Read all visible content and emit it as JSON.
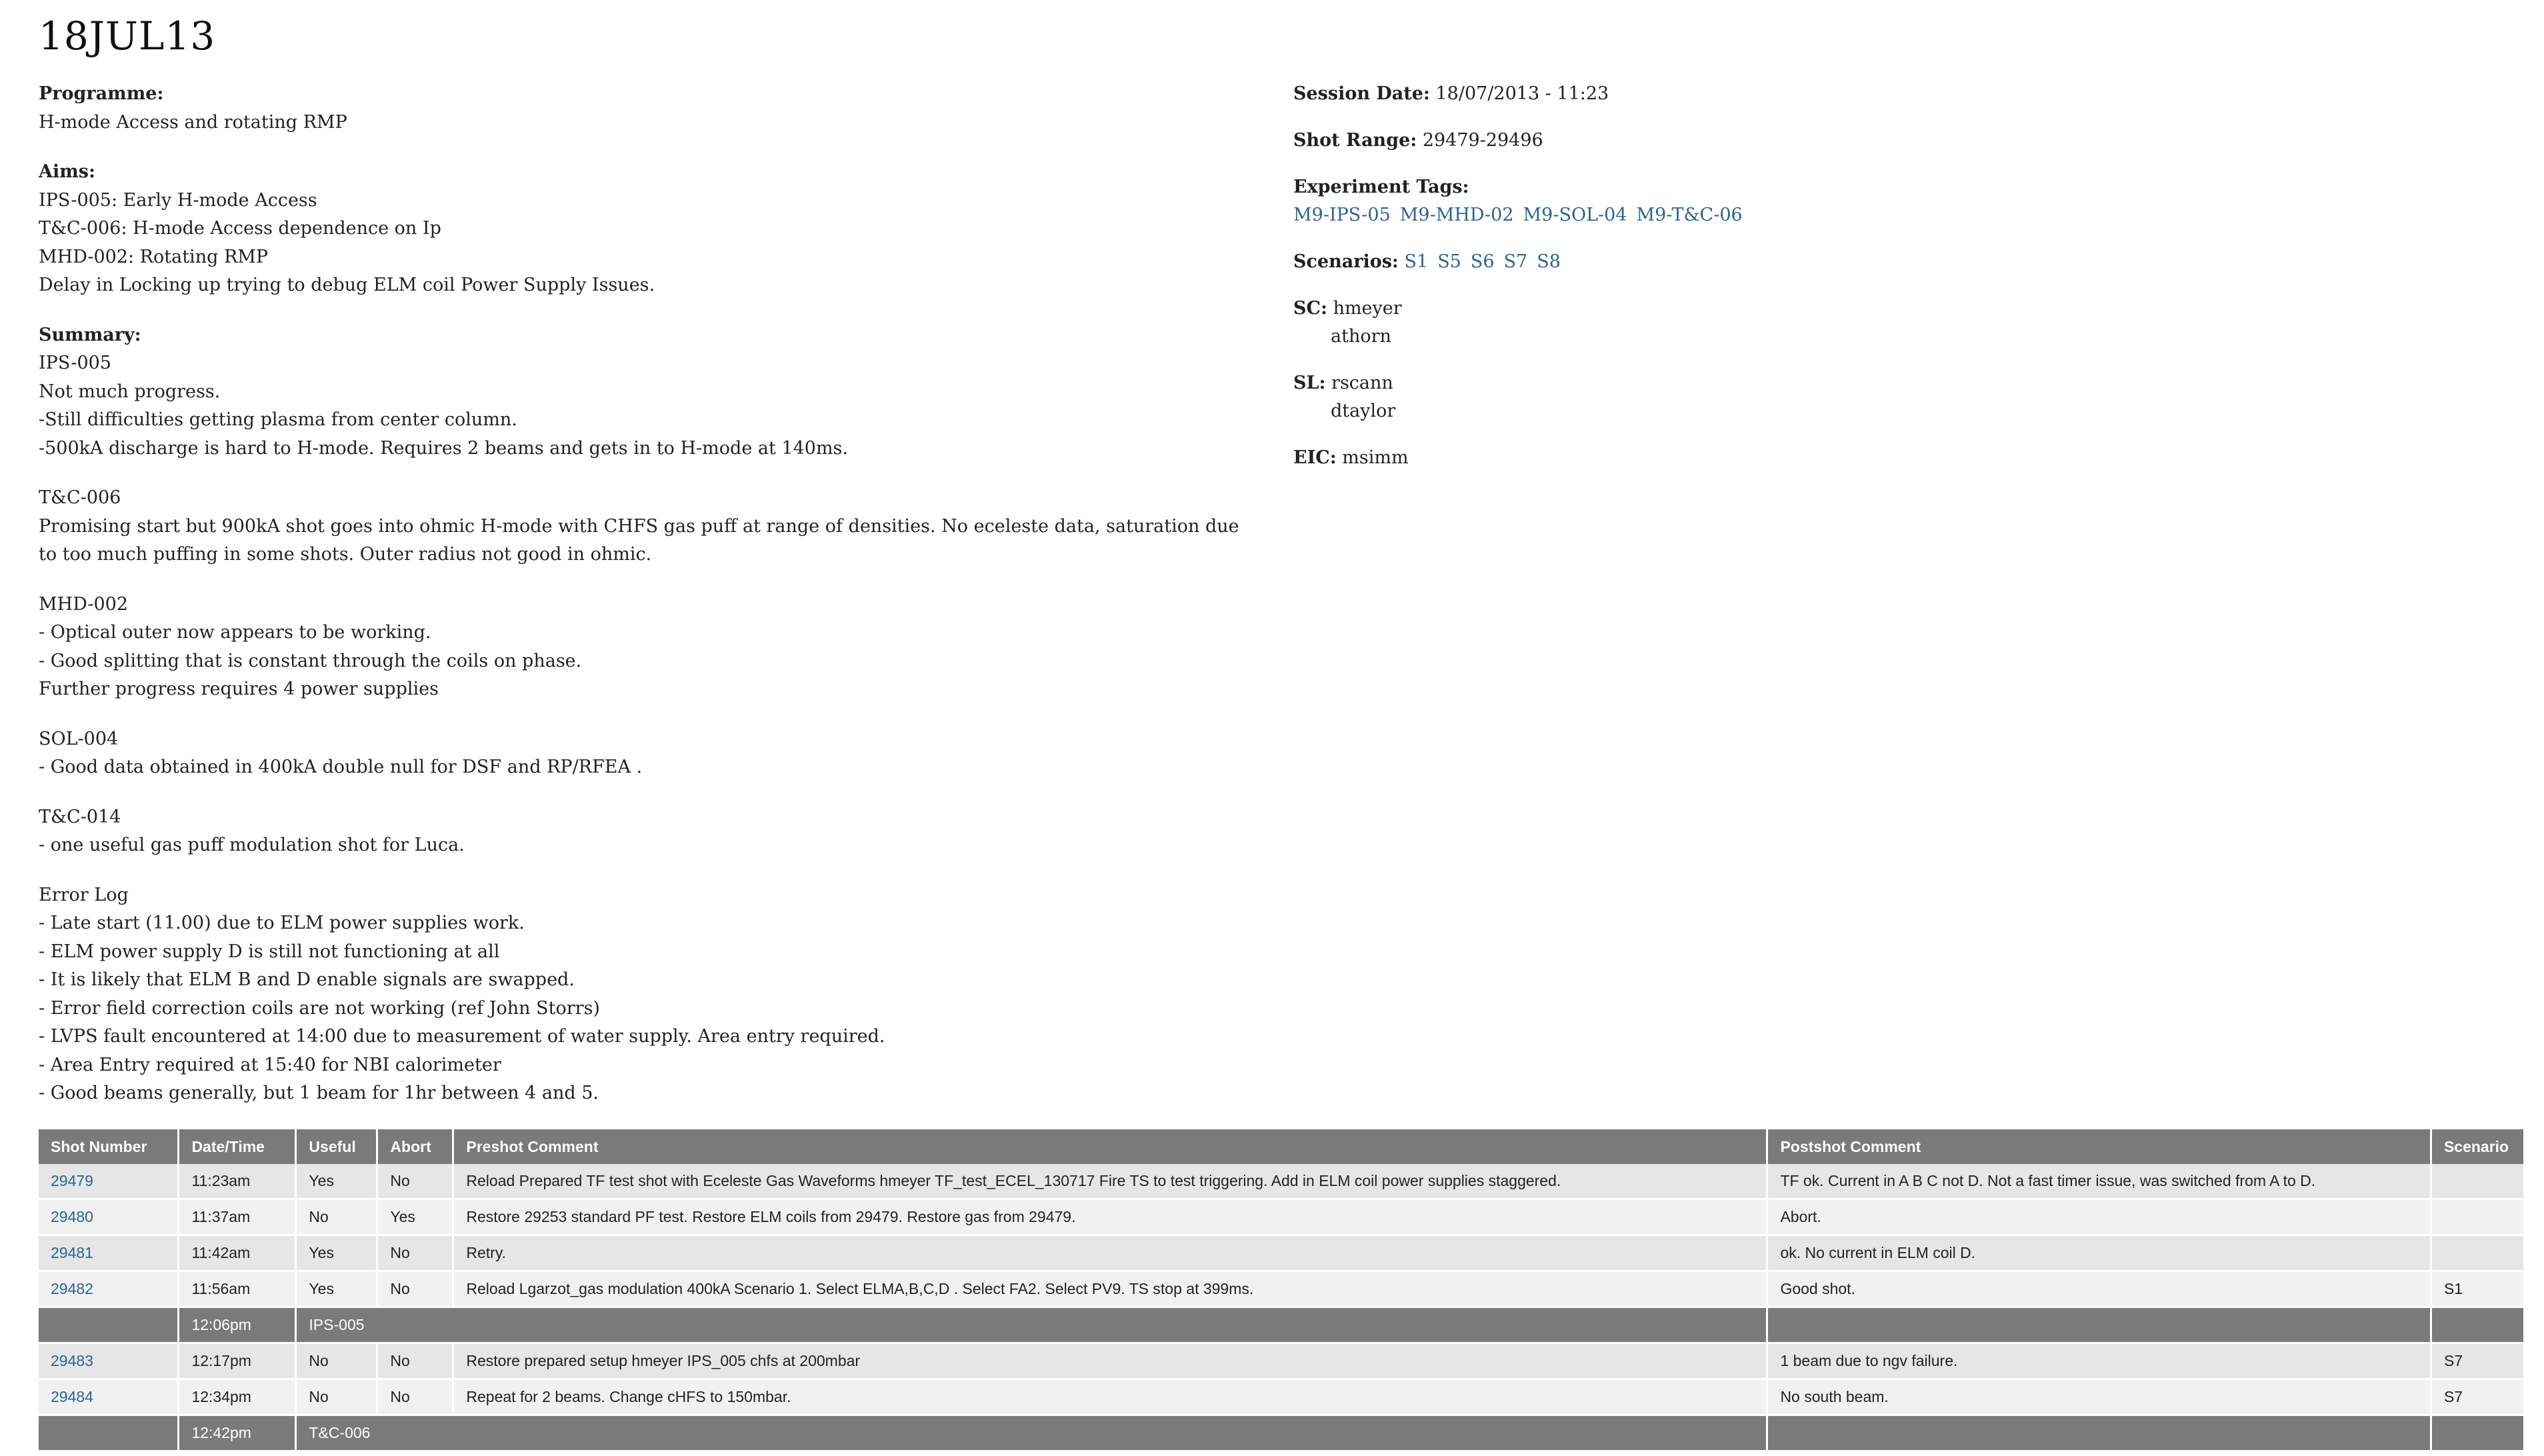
{
  "title": "18JUL13",
  "programme": {
    "label": "Programme:",
    "value": "H-mode Access and rotating RMP"
  },
  "aims": {
    "label": "Aims:",
    "lines": [
      "IPS-005: Early H-mode Access",
      "T&C-006: H-mode Access dependence on Ip",
      "MHD-002: Rotating RMP",
      "Delay in Locking up trying to debug ELM coil Power Supply Issues."
    ]
  },
  "summary": {
    "label": "Summary:",
    "sections": [
      {
        "lines": [
          "IPS-005",
          "Not much progress.",
          "-Still difficulties getting plasma from center column.",
          "-500kA discharge is hard to H-mode. Requires 2 beams and gets in to H-mode at 140ms."
        ]
      },
      {
        "lines": [
          "T&C-006",
          "Promising start but 900kA shot goes into ohmic H-mode with CHFS gas puff at range of densities. No eceleste data, saturation due to too much puffing in some shots. Outer radius not good in ohmic."
        ]
      },
      {
        "lines": [
          "MHD-002",
          "- Optical outer now appears to be working.",
          "- Good splitting that is constant through the coils on phase.",
          "Further progress requires 4 power supplies"
        ]
      },
      {
        "lines": [
          "SOL-004",
          "- Good data obtained in 400kA double null for DSF and RP/RFEA ."
        ]
      },
      {
        "lines": [
          "T&C-014",
          "- one useful gas puff modulation shot for Luca."
        ]
      },
      {
        "lines": [
          "Error Log",
          "- Late start (11.00) due to ELM power supplies work.",
          "- ELM power supply D is still not functioning at all",
          "- It is likely that ELM B and D enable signals are swapped.",
          "- Error field correction coils are not working (ref John Storrs)",
          "- LVPS fault encountered at 14:00 due to measurement of water supply. Area entry required.",
          "- Area Entry required at 15:40 for NBI calorimeter",
          "- Good beams generally, but 1 beam for 1hr between 4 and 5."
        ]
      }
    ]
  },
  "session": {
    "date_label": "Session Date:",
    "date_value": "18/07/2013 - 11:23",
    "range_label": "Shot Range:",
    "range_value": "29479-29496",
    "tags_label": "Experiment Tags:",
    "tags": [
      "M9-IPS-05",
      "M9-MHD-02",
      "M9-SOL-04",
      "M9-T&C-06"
    ],
    "scenarios_label": "Scenarios:",
    "scenarios": [
      "S1",
      "S5",
      "S6",
      "S7",
      "S8"
    ],
    "sc_label": "SC:",
    "sc": [
      "hmeyer",
      "athorn"
    ],
    "sl_label": "SL:",
    "sl": [
      "rscann",
      "dtaylor"
    ],
    "eic_label": "EIC:",
    "eic": "msimm"
  },
  "table": {
    "headers": [
      "Shot Number",
      "Date/Time",
      "Useful",
      "Abort",
      "Preshot Comment",
      "Postshot Comment",
      "Scenario"
    ],
    "rows": [
      {
        "type": "shot",
        "shot": "29479",
        "time": "11:23am",
        "useful": "Yes",
        "abort": "No",
        "pre": "Reload Prepared TF test shot with Eceleste Gas Waveforms hmeyer TF_test_ECEL_130717 Fire TS to test triggering. Add in ELM coil power supplies staggered.",
        "post": "TF ok. Current in A B C not D. Not a fast timer issue, was switched from A to D.",
        "scenario": ""
      },
      {
        "type": "shot",
        "shot": "29480",
        "time": "11:37am",
        "useful": "No",
        "abort": "Yes",
        "pre": "Restore 29253 standard PF test. Restore ELM coils from 29479. Restore gas from 29479.",
        "post": "Abort.",
        "scenario": ""
      },
      {
        "type": "shot",
        "shot": "29481",
        "time": "11:42am",
        "useful": "Yes",
        "abort": "No",
        "pre": "Retry.",
        "post": "ok. No current in ELM coil D.",
        "scenario": ""
      },
      {
        "type": "shot",
        "shot": "29482",
        "time": "11:56am",
        "useful": "Yes",
        "abort": "No",
        "pre": "Reload Lgarzot_gas modulation 400kA Scenario 1. Select ELMA,B,C,D . Select FA2. Select PV9. TS stop at 399ms.",
        "post": "Good shot.",
        "scenario": "S1"
      },
      {
        "type": "sep",
        "time": "12:06pm",
        "label": "IPS-005"
      },
      {
        "type": "shot",
        "shot": "29483",
        "time": "12:17pm",
        "useful": "No",
        "abort": "No",
        "pre": "Restore prepared setup hmeyer IPS_005 chfs at 200mbar",
        "post": "1 beam due to ngv failure.",
        "scenario": "S7"
      },
      {
        "type": "shot",
        "shot": "29484",
        "time": "12:34pm",
        "useful": "No",
        "abort": "No",
        "pre": "Repeat for 2 beams. Change cHFS to 150mbar.",
        "post": "No south beam.",
        "scenario": "S7"
      },
      {
        "type": "sep",
        "time": "12:42pm",
        "label": "T&C-006"
      }
    ]
  }
}
